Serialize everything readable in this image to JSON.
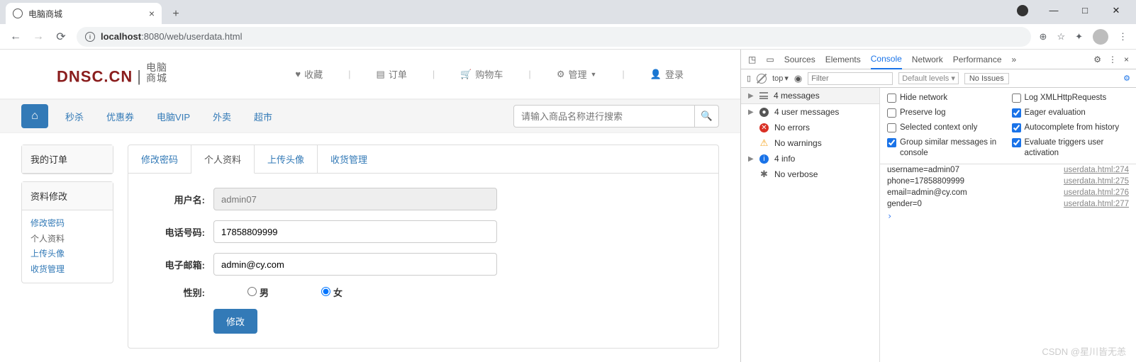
{
  "browser": {
    "tab_title": "电脑商城",
    "url_host": "localhost",
    "url_port": ":8080",
    "url_path": "/web/userdata.html",
    "min": "—",
    "max": "□",
    "close": "✕"
  },
  "header": {
    "logo_main": "DNSC.CN",
    "logo_sub1": "电脑",
    "logo_sub2": "商城",
    "nav": {
      "fav": "收藏",
      "order": "订单",
      "cart": "购物车",
      "admin": "管理",
      "login": "登录"
    }
  },
  "navbar": {
    "links": [
      "秒杀",
      "优惠券",
      "电脑VIP",
      "外卖",
      "超市"
    ],
    "search_placeholder": "请输入商品名称进行搜索"
  },
  "sidebar": {
    "card1": "我的订单",
    "card2": "资料修改",
    "links": [
      "修改密码",
      "个人资料",
      "上传头像",
      "收货管理"
    ]
  },
  "tabs": [
    "修改密码",
    "个人资料",
    "上传头像",
    "收货管理"
  ],
  "form": {
    "username_label": "用户名:",
    "username": "admin07",
    "phone_label": "电话号码:",
    "phone": "17858809999",
    "email_label": "电子邮箱:",
    "email": "admin@cy.com",
    "gender_label": "性别:",
    "male": "男",
    "female": "女",
    "submit": "修改"
  },
  "devtools": {
    "tabs": [
      "Sources",
      "Elements",
      "Console",
      "Network",
      "Performance"
    ],
    "top": "top",
    "filter_placeholder": "Filter",
    "levels": "Default levels",
    "issues": "No Issues",
    "left": {
      "messages": "4 messages",
      "user": "4 user messages",
      "errors": "No errors",
      "warnings": "No warnings",
      "info": "4 info",
      "verbose": "No verbose"
    },
    "settings": {
      "hide_network": "Hide network",
      "log_xhr": "Log XMLHttpRequests",
      "preserve": "Preserve log",
      "eager": "Eager evaluation",
      "selected": "Selected context only",
      "autocomplete": "Autocomplete from history",
      "group": "Group similar messages in console",
      "triggers": "Evaluate triggers user activation"
    },
    "logs": [
      {
        "msg": "username=admin07",
        "src": "userdata.html:274"
      },
      {
        "msg": "phone=17858809999",
        "src": "userdata.html:275"
      },
      {
        "msg": "email=admin@cy.com",
        "src": "userdata.html:276"
      },
      {
        "msg": "gender=0",
        "src": "userdata.html:277"
      }
    ]
  },
  "watermark": "CSDN @星川皆无恙"
}
